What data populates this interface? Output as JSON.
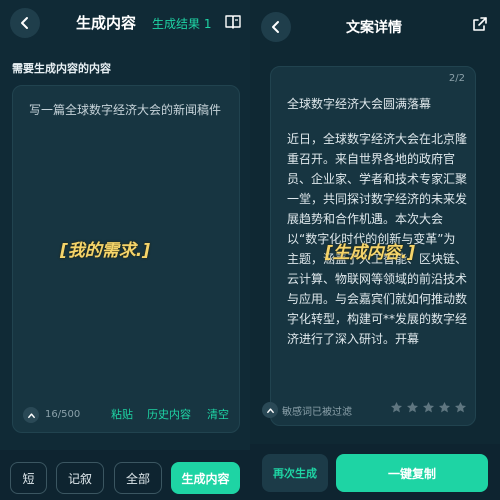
{
  "left": {
    "header": {
      "title": "生成内容",
      "tab": "生成结果 1"
    },
    "section_label": "需要生成内容的内容",
    "input": {
      "value": "写一篇全球数字经济大会的新闻稿件",
      "char_count": "16/500"
    },
    "annotation": "[我的需求.]",
    "actions": {
      "paste": "粘贴",
      "history": "历史内容",
      "clear": "清空"
    },
    "chips": {
      "short": "短",
      "narrative": "记叙",
      "all": "全部",
      "generate": "生成内容"
    }
  },
  "right": {
    "header": {
      "title": "文案详情"
    },
    "page_indicator": "2/2",
    "result_title": "全球数字经济大会圆满落幕",
    "result_body": "近日，全球数字经济大会在北京隆重召开。来自世界各地的政府官员、企业家、学者和技术专家汇聚一堂，共同探讨数字经济的未来发展趋势和合作机遇。本次大会以“数字化时代的创新与变革”为主题，涵盖了人工智能、区块链、云计算、物联网等领域的前沿技术与应用。与会嘉宾们就如何推动数字化转型，构建可**发展的数字经济进行了深入研讨。开幕",
    "annotation": "[生成内容.]",
    "sensitivity_text": "敏感词已被过滤",
    "rating_stars": 5,
    "buttons": {
      "regenerate": "再次生成",
      "copy": "一键复制"
    }
  },
  "colors": {
    "accent": "#1ed4a4",
    "annotation": "#f5d46a",
    "background": "#0f2630",
    "card": "#173541"
  },
  "icons": [
    "back-arrow-icon",
    "book-icon",
    "share-icon",
    "chevron-up-icon",
    "star-icon"
  ]
}
